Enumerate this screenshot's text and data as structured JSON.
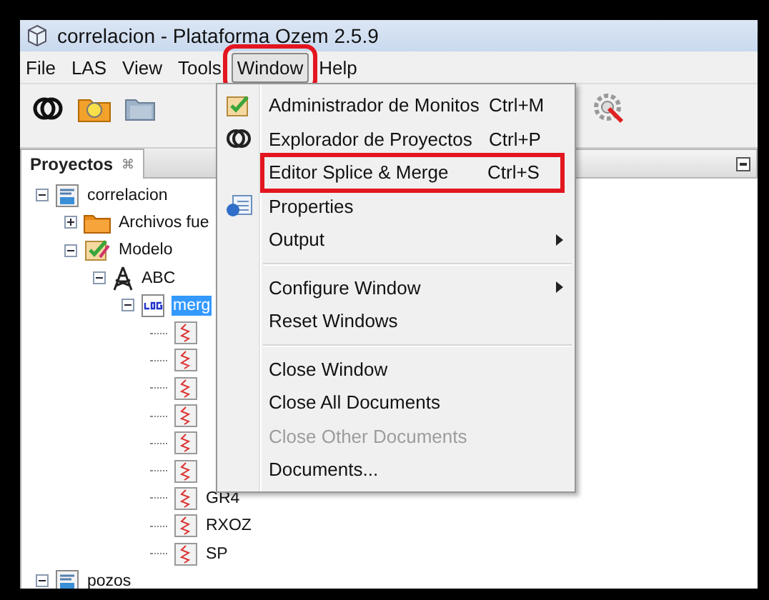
{
  "window": {
    "title": "correlacion - Plataforma Ozem 2.5.9"
  },
  "menubar": [
    {
      "label": "File",
      "selected": false,
      "highlighted": false
    },
    {
      "label": "LAS",
      "selected": false,
      "highlighted": false
    },
    {
      "label": "View",
      "selected": false,
      "highlighted": false
    },
    {
      "label": "Tools",
      "selected": false,
      "highlighted": false
    },
    {
      "label": "Window",
      "selected": true,
      "highlighted": true
    },
    {
      "label": "Help",
      "selected": false,
      "highlighted": false
    }
  ],
  "projects_panel": {
    "tab": "Proyectos",
    "tab_close": "⌘",
    "tree": [
      {
        "label": "correlacion",
        "kind": "las",
        "expanded": true,
        "selected": false,
        "children": [
          {
            "label": "Archivos fue",
            "kind": "folder",
            "expanded": false,
            "selected": false
          },
          {
            "label": "Modelo",
            "kind": "model",
            "expanded": true,
            "selected": false,
            "children": [
              {
                "label": "ABC",
                "kind": "tower",
                "expanded": true,
                "selected": false,
                "children": [
                  {
                    "label": "merg",
                    "kind": "log",
                    "expanded": true,
                    "selected": true,
                    "children": [
                      {
                        "kind": "curve"
                      },
                      {
                        "kind": "curve"
                      },
                      {
                        "kind": "curve"
                      },
                      {
                        "kind": "curve"
                      },
                      {
                        "kind": "curve"
                      },
                      {
                        "kind": "curve"
                      },
                      {
                        "label": "GR4",
                        "kind": "curve",
                        "selected": false
                      },
                      {
                        "label": "RXOZ",
                        "kind": "curve",
                        "selected": false
                      },
                      {
                        "label": "SP",
                        "kind": "curve",
                        "selected": false
                      }
                    ]
                  }
                ]
              }
            ]
          }
        ]
      },
      {
        "label": "pozos",
        "kind": "las",
        "expanded": true,
        "selected": false
      }
    ]
  },
  "window_menu": [
    {
      "kind": "item",
      "label": "Administrador de Monitos",
      "shortcut": "Ctrl+M",
      "highlighted": false,
      "disabled": false
    },
    {
      "kind": "item",
      "label": "Explorador de Proyectos",
      "shortcut": "Ctrl+P",
      "highlighted": false,
      "disabled": false
    },
    {
      "kind": "item",
      "label": "Editor Splice & Merge",
      "shortcut": "Ctrl+S",
      "highlighted": true,
      "disabled": false
    },
    {
      "kind": "item",
      "label": "Properties",
      "highlighted": false,
      "disabled": false
    },
    {
      "kind": "submenu",
      "label": "Output",
      "highlighted": false,
      "disabled": false
    },
    {
      "kind": "separator"
    },
    {
      "kind": "submenu",
      "label": "Configure Window",
      "highlighted": false,
      "disabled": false
    },
    {
      "kind": "item",
      "label": "Reset Windows",
      "highlighted": false,
      "disabled": false
    },
    {
      "kind": "separator"
    },
    {
      "kind": "item",
      "label": "Close Window",
      "highlighted": false,
      "disabled": false
    },
    {
      "kind": "item",
      "label": "Close All Documents",
      "highlighted": false,
      "disabled": false
    },
    {
      "kind": "item",
      "label": "Close Other Documents",
      "highlighted": false,
      "disabled": true
    },
    {
      "kind": "item",
      "label": "Documents...",
      "highlighted": false,
      "disabled": false
    }
  ]
}
